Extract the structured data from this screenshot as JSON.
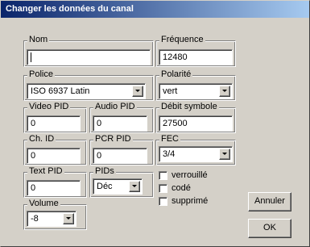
{
  "window": {
    "title": "Changer les données du canal"
  },
  "nom": {
    "label": "Nom",
    "value": ""
  },
  "frequence": {
    "label": "Fréquence",
    "value": "12480"
  },
  "police": {
    "label": "Police",
    "value": "ISO 6937 Latin"
  },
  "polarite": {
    "label": "Polarité",
    "value": "vert"
  },
  "video_pid": {
    "label": "Video PID",
    "value": "0"
  },
  "audio_pid": {
    "label": "Audio PID",
    "value": "0"
  },
  "debit_symbole": {
    "label": "Débit symbole",
    "value": "27500"
  },
  "ch_id": {
    "label": "Ch. ID",
    "value": "0"
  },
  "pcr_pid": {
    "label": "PCR PID",
    "value": "0"
  },
  "fec": {
    "label": "FEC",
    "value": "3/4"
  },
  "text_pid": {
    "label": "Text PID",
    "value": "0"
  },
  "pids": {
    "label": "PIDs",
    "value": "Déc"
  },
  "checkboxes": {
    "verrouille": {
      "label": "verrouillé",
      "checked": false
    },
    "code": {
      "label": "codé",
      "checked": false
    },
    "supprime": {
      "label": "supprimé",
      "checked": false
    }
  },
  "volume": {
    "label": "Volume",
    "value": "-8"
  },
  "buttons": {
    "annuler": "Annuler",
    "ok": "OK"
  }
}
